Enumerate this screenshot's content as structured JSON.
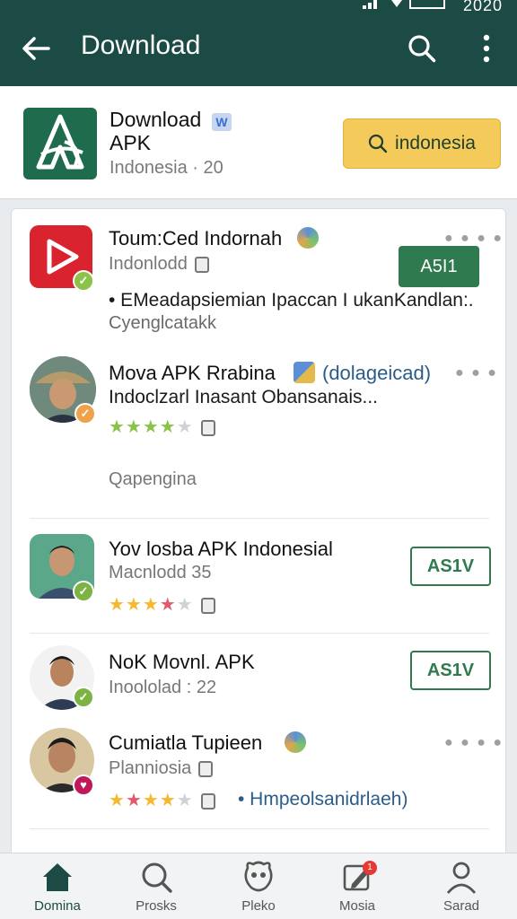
{
  "status": {
    "time": "2020"
  },
  "appbar": {
    "title": "Download"
  },
  "hero": {
    "name_line1": "Download",
    "badge": "W",
    "name_line2": "APK",
    "subtitle": "Indonesia · 20",
    "cta_label": "indonesia"
  },
  "items": [
    {
      "title": "Toum:Ced Indornah",
      "subtitle": "Indonlodd",
      "body1": "• EMeadapsiemian Ipaccan I ukanKandlan:.",
      "body2": "Cyenglcatakk"
    },
    {
      "title": "Mova APK Rrabina",
      "tag": "(dolageicad)",
      "subtitle": "Indoclzarl Inasant Obansanais...",
      "rating": 4,
      "footer": "Qapengina",
      "button": "A5I1"
    },
    {
      "title": "Yov losba APK Indonesial",
      "subtitle": "Macnlodd 35",
      "rating": 4,
      "button": "AS1V"
    },
    {
      "title": "NoK Movnl. APK",
      "subtitle": "Inoololad : 22",
      "button": "AS1V"
    },
    {
      "title": "Cumiatla Tupieen",
      "subtitle": "Planniosia",
      "rating": 4,
      "link": "• Hmpeolsanidrlaeh)"
    }
  ],
  "nav": [
    {
      "label": "Domina",
      "icon": "home-icon"
    },
    {
      "label": "Prosks",
      "icon": "search-icon"
    },
    {
      "label": "Pleko",
      "icon": "mascot-icon"
    },
    {
      "label": "Mosia",
      "icon": "edit-icon",
      "badge": "1"
    },
    {
      "label": "Sarad",
      "icon": "person-icon"
    }
  ],
  "colors": {
    "primary": "#1c4a45",
    "accent": "#f4cb5a",
    "green": "#2f7a4f",
    "app_red": "#d9232e"
  }
}
